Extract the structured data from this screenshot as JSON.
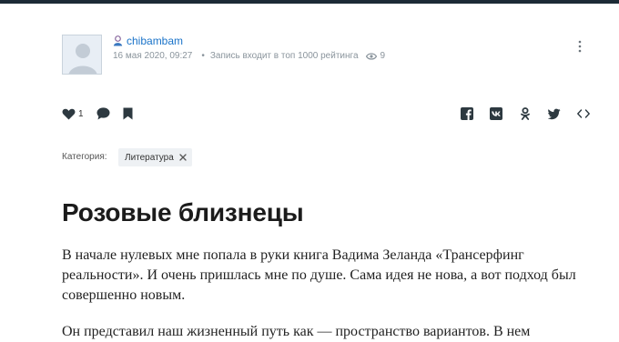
{
  "post": {
    "author": "chibambam",
    "date": "16 мая 2020, 09:27",
    "rating_note": "Запись входит в топ 1000 рейтинга",
    "views": "9",
    "likes": "1"
  },
  "icons": {
    "user": "user-icon",
    "eye": "eye-icon",
    "more": "more-dots-icon",
    "like": "heart-icon",
    "comment": "comment-icon",
    "bookmark": "bookmark-icon",
    "share": [
      "facebook-icon",
      "vk-icon",
      "odnoklassniki-icon",
      "twitter-icon",
      "embed-code-icon"
    ]
  },
  "category": {
    "label": "Категория:",
    "value": "Литература"
  },
  "article": {
    "title": "Розовые близнецы",
    "paragraphs": [
      "В начале нулевых мне попала в руки книга Вадима Зеланда «Трансерфинг реальности». И очень пришлась мне по душе. Сама идея не нова, а вот подход был совершенно новым.",
      "Он представил наш жизненный путь как — пространство вариантов. В нем"
    ]
  },
  "colors": {
    "topbar": "#1c2b36",
    "author_link": "#1a73c9",
    "meta_text": "#8a949c",
    "icon": "#2d3940",
    "tag_bg": "#eef1f4"
  }
}
